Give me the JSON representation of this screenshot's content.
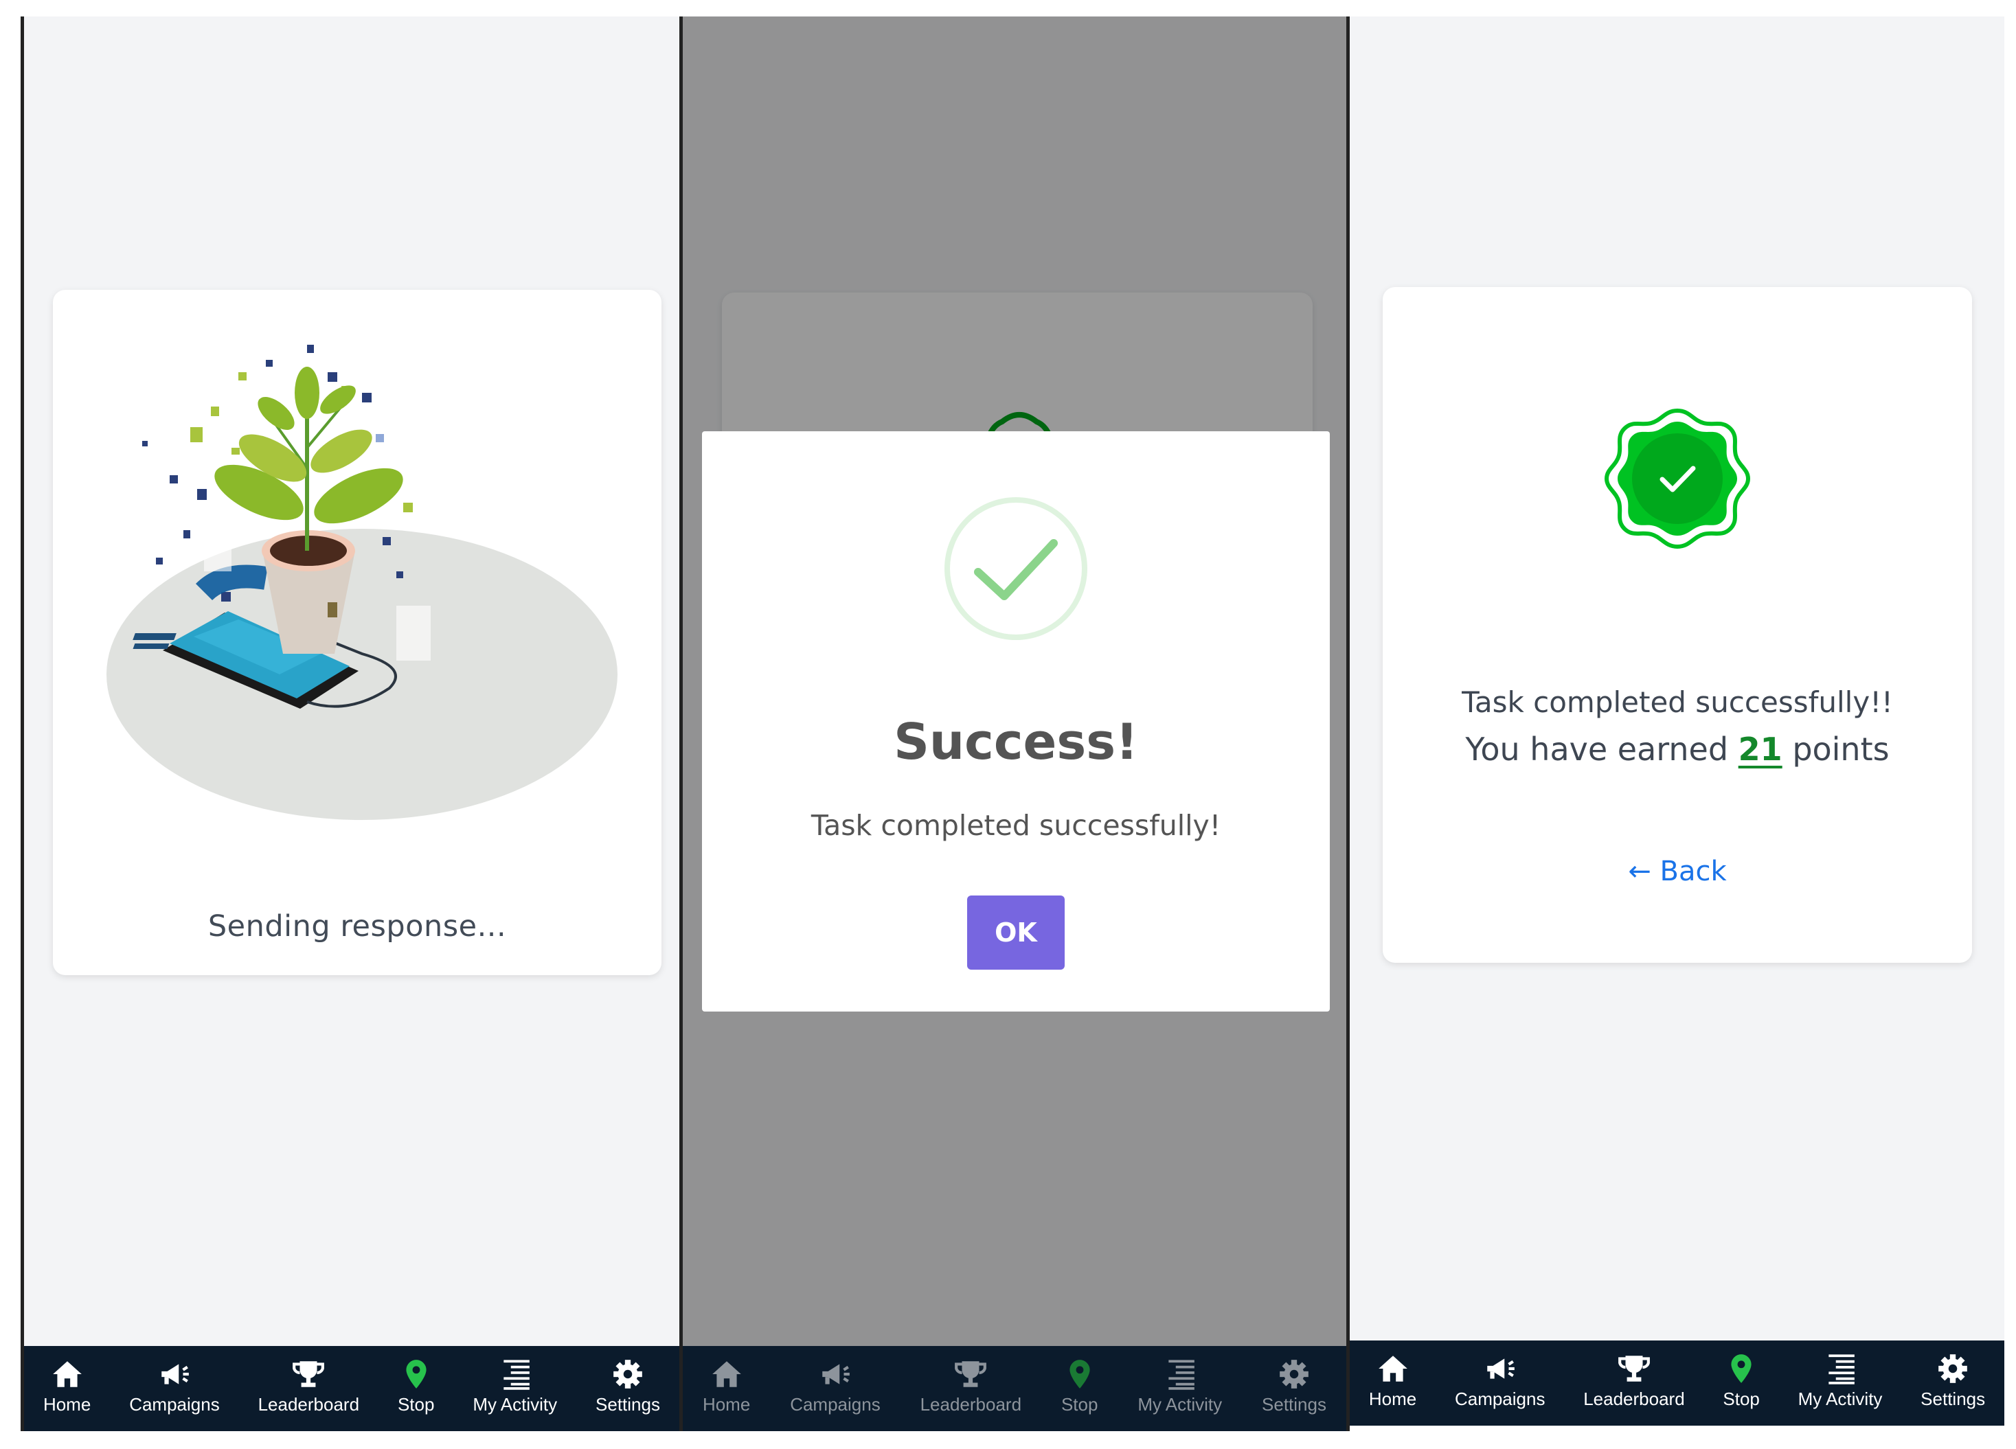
{
  "screens": {
    "sending": {
      "message": "Sending response..."
    },
    "success_modal": {
      "title": "Success!",
      "text": "Task completed successfully!",
      "ok_label": "OK"
    },
    "completed": {
      "line1": "Task completed successfully!!",
      "earned_prefix": "You have earned",
      "points": "21",
      "earned_suffix": "points",
      "back_label": "← Back"
    }
  },
  "nav": {
    "home": "Home",
    "campaigns": "Campaigns",
    "leaderboard": "Leaderboard",
    "stop": "Stop",
    "activity": "My Activity",
    "settings": "Settings"
  },
  "icons": {
    "home": "home-icon",
    "campaigns": "megaphone-icon",
    "leaderboard": "trophy-icon",
    "stop": "location-pin-icon",
    "activity": "list-icon",
    "settings": "gear-icon"
  },
  "colors": {
    "nav_bg": "#0b1b2c",
    "accent_purple": "#7766e0",
    "success_green": "#14882b",
    "badge_green": "#00c222",
    "link_blue": "#1a73e8",
    "stop_pin": "#27c24c",
    "overlay": "rgba(0,0,0,0.40)"
  }
}
